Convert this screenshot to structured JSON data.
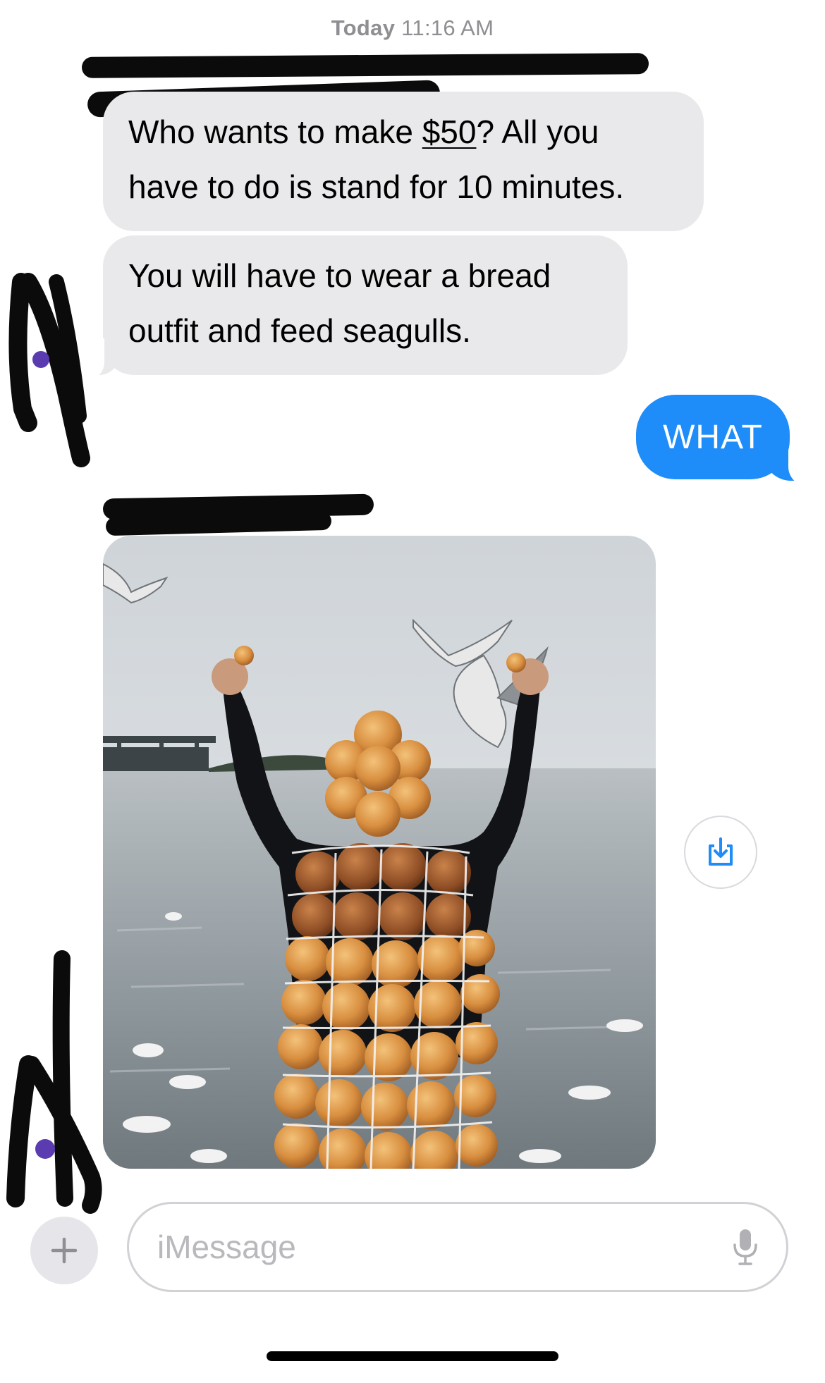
{
  "header": {
    "day_label": "Today",
    "time_label": "11:16 AM"
  },
  "messages": [
    {
      "direction": "incoming",
      "line1_pre": "Who wants to make ",
      "line1_link": "$50",
      "line1_post": "? All you",
      "line2": "have to do is stand for 10 minutes."
    },
    {
      "direction": "incoming",
      "line1": "You will have to wear a bread",
      "line2": "outfit and feed seagulls."
    },
    {
      "direction": "outgoing",
      "text": "WHAT"
    },
    {
      "direction": "incoming",
      "type": "image"
    }
  ],
  "composer": {
    "placeholder": "iMessage",
    "plus_icon": "plus-icon",
    "mic_icon": "microphone-icon"
  },
  "colors": {
    "incoming_bubble": "#e9e9eb",
    "outgoing_bubble": "#1e8cf9",
    "timestamp": "#8e8e93"
  },
  "icons": {
    "save": "save-download-icon"
  }
}
